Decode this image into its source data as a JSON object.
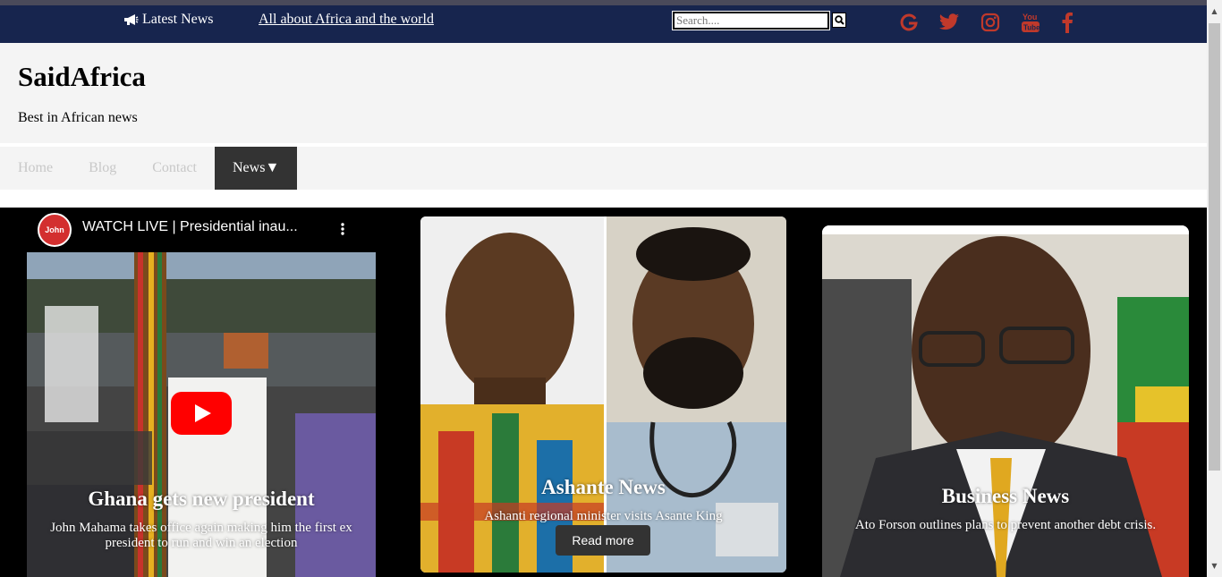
{
  "topbar": {
    "latest_label": "Latest News",
    "tagline": "All about Africa and the world",
    "search_placeholder": "Search....",
    "social_icons": [
      "google-icon",
      "twitter-icon",
      "instagram-icon",
      "youtube-icon",
      "facebook-icon"
    ],
    "social_color": "#c0392b",
    "background": "#17254e"
  },
  "header": {
    "title": "SaidAfrica",
    "subtitle": "Best in African news"
  },
  "nav": {
    "items": [
      {
        "label": "Home"
      },
      {
        "label": "Blog"
      },
      {
        "label": "Contact"
      },
      {
        "label": "News▼"
      }
    ]
  },
  "video": {
    "title": "WATCH LIVE | Presidential inau...",
    "channel_label": "John"
  },
  "cards": [
    {
      "title": "Ghana gets new president",
      "desc": "John Mahama takes office again making him the first ex president to run and win an election"
    },
    {
      "title": "Ashante News",
      "desc": "Ashanti regional minister visits Asante King",
      "button": "Read more"
    },
    {
      "title": "Business News",
      "desc": "Ato Forson outlines plans to prevent another debt crisis."
    }
  ]
}
